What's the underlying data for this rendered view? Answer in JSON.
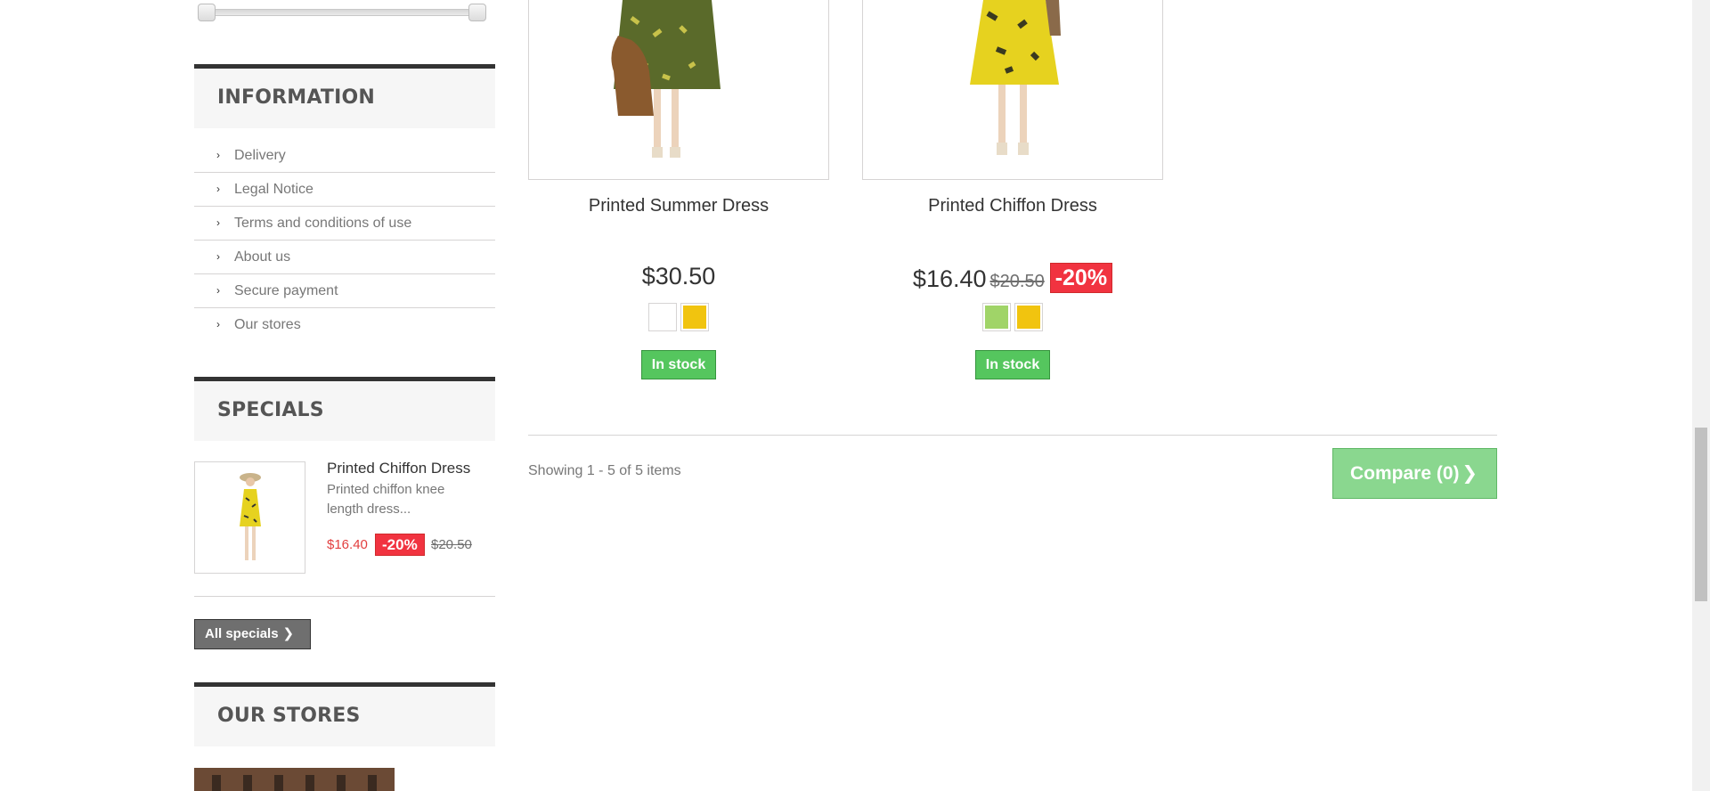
{
  "sidebar": {
    "information": {
      "title": "INFORMATION",
      "items": [
        {
          "label": "Delivery"
        },
        {
          "label": "Legal Notice"
        },
        {
          "label": "Terms and conditions of use"
        },
        {
          "label": "About us"
        },
        {
          "label": "Secure payment"
        },
        {
          "label": "Our stores"
        }
      ]
    },
    "specials": {
      "title": "SPECIALS",
      "product": {
        "name": "Printed Chiffon Dress",
        "description": "Printed chiffon knee length dress...",
        "price": "$16.40",
        "discount": "-20%",
        "old_price": "$20.50"
      },
      "all_button": "All specials"
    },
    "stores": {
      "title": "OUR STORES"
    }
  },
  "products": [
    {
      "name": "Printed Summer Dress",
      "price": "$30.50",
      "old_price": "",
      "discount": "",
      "colors": [
        "#ffffff",
        "#f1c40f"
      ],
      "availability": "In stock"
    },
    {
      "name": "Printed Chiffon Dress",
      "price": "$16.40",
      "old_price": "$20.50",
      "discount": "-20%",
      "colors": [
        "#a0d468",
        "#f1c40f"
      ],
      "availability": "In stock"
    }
  ],
  "listing": {
    "showing": "Showing 1 - 5 of 5 items",
    "compare_label": "Compare (0)"
  },
  "icons": {
    "chevron": "chevron-right-icon"
  },
  "colors": {
    "stock_green": "#55c65e",
    "discount_red": "#f13340",
    "compare_green": "#8ad78f",
    "title_bar": "#333333"
  }
}
